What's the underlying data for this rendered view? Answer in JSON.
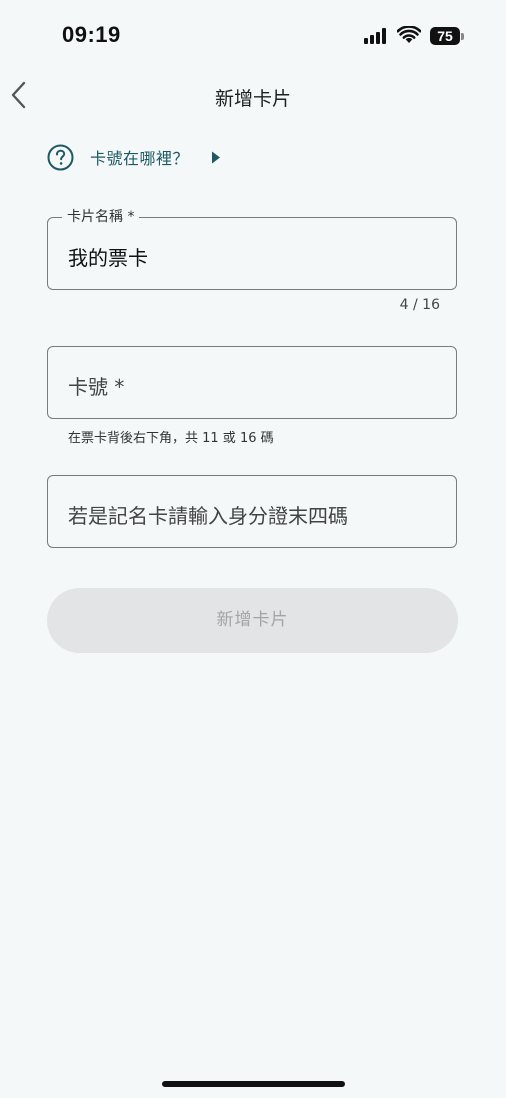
{
  "status_bar": {
    "time": "09:19",
    "battery_level": "75"
  },
  "header": {
    "title": "新增卡片"
  },
  "help_link": {
    "label": "卡號在哪裡？"
  },
  "form": {
    "card_name": {
      "label": "卡片名稱 *",
      "value": "我的票卡",
      "counter": "4 / 16"
    },
    "card_number": {
      "placeholder": "卡號 *",
      "helper": "在票卡背後右下角，共 11 或 16 碼"
    },
    "id_last_four": {
      "placeholder": "若是記名卡請輸入身分證末四碼"
    },
    "submit_label": "新增卡片"
  },
  "colors": {
    "background": "#f4f8f9",
    "accent": "#1c5963",
    "button_disabled_bg": "#e2e4e6",
    "button_disabled_text": "#a2a5a8"
  }
}
